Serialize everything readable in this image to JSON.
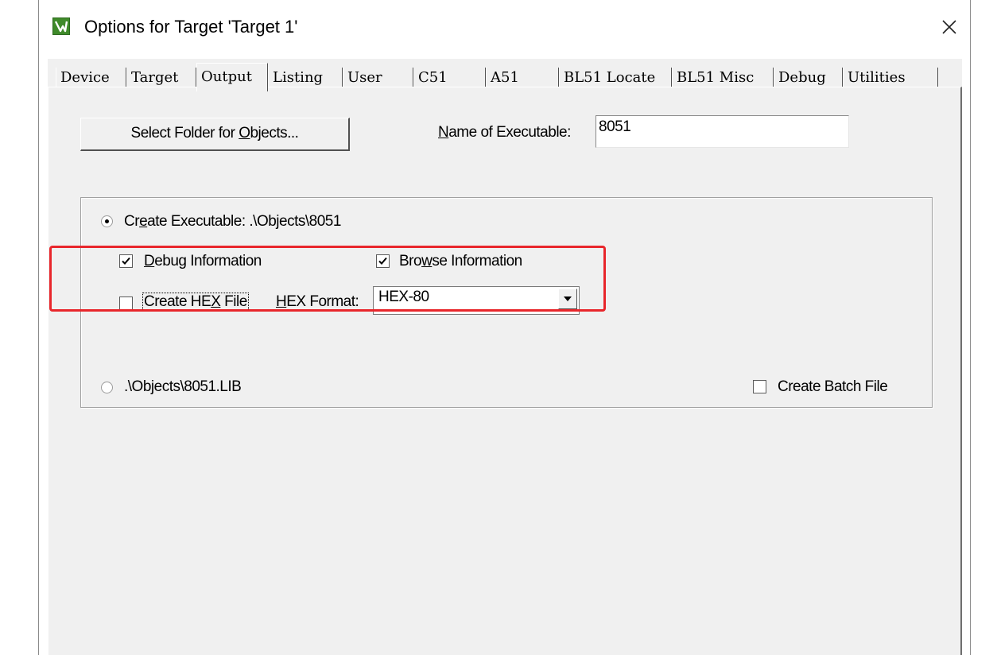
{
  "window": {
    "title": "Options for Target 'Target 1'",
    "app_icon": "keil-uvision-icon",
    "close_icon": "close-icon"
  },
  "tabs": [
    {
      "label": "Device",
      "active": false
    },
    {
      "label": "Target",
      "active": false
    },
    {
      "label": "Output",
      "active": true
    },
    {
      "label": "Listing",
      "active": false
    },
    {
      "label": "User",
      "active": false
    },
    {
      "label": "C51",
      "active": false
    },
    {
      "label": "A51",
      "active": false
    },
    {
      "label": "BL51 Locate",
      "active": false
    },
    {
      "label": "BL51 Misc",
      "active": false
    },
    {
      "label": "Debug",
      "active": false
    },
    {
      "label": "Utilities",
      "active": false
    }
  ],
  "output": {
    "select_folder_button": {
      "pre": "Select Folder for ",
      "mnemonic": "O",
      "post": "bjects..."
    },
    "name_of_executable": {
      "mnemonic": "N",
      "label_rest": "ame of Executable:",
      "value": "8051"
    },
    "create_executable": {
      "pre": "Cr",
      "mnemonic": "e",
      "post": "ate Executable:  .\\Objects\\8051",
      "selected": true
    },
    "debug_information": {
      "mnemonic": "D",
      "rest": "ebug Information",
      "checked": true
    },
    "browse_information": {
      "pre": "Bro",
      "mnemonic": "w",
      "post": "se Information",
      "checked": true
    },
    "create_hex_file": {
      "pre": "Create HE",
      "mnemonic": "X",
      "post": " File",
      "checked": false
    },
    "hex_format": {
      "mnemonic": "H",
      "label_rest": "EX Format:",
      "selected": "HEX-80"
    },
    "create_library": {
      "label": ".\\Objects\\8051.LIB",
      "selected": false
    },
    "create_batch_file": {
      "label": "Create Batch File",
      "checked": false
    }
  },
  "colors": {
    "highlight_border": "#e8262b",
    "dialog_bg": "#f0f0f0",
    "app_icon_green": "#3f8a2a"
  }
}
